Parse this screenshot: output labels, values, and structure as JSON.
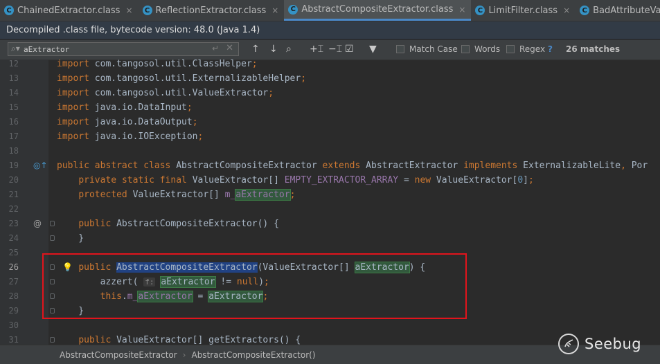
{
  "tabs": [
    {
      "label": "ChainedExtractor.class",
      "active": false
    },
    {
      "label": "ReflectionExtractor.class",
      "active": false
    },
    {
      "label": "AbstractCompositeExtractor.class",
      "active": true
    },
    {
      "label": "LimitFilter.class",
      "active": false
    },
    {
      "label": "BadAttributeValueExpException",
      "active": false
    }
  ],
  "tab_icon_letter": "C",
  "tab_close_glyph": "×",
  "banner": {
    "text": "Decompiled .class file, bytecode version: 48.0 (Java 1.4)"
  },
  "find": {
    "query": "aExtractor",
    "options": {
      "match_case": "Match Case",
      "words": "Words",
      "regex": "Regex",
      "help": "?"
    },
    "matches": "26 matches"
  },
  "code_lines": [
    {
      "n": "12",
      "text": "import com.tangosol.util.ClassHelper;"
    },
    {
      "n": "13",
      "text": "import com.tangosol.util.ExternalizableHelper;"
    },
    {
      "n": "14",
      "text": "import com.tangosol.util.ValueExtractor;"
    },
    {
      "n": "15",
      "text": "import java.io.DataInput;"
    },
    {
      "n": "16",
      "text": "import java.io.DataOutput;"
    },
    {
      "n": "17",
      "text": "import java.io.IOException;"
    },
    {
      "n": "18",
      "text": ""
    },
    {
      "n": "19",
      "text": "public abstract class AbstractCompositeExtractor extends AbstractExtractor implements ExternalizableLite, Por"
    },
    {
      "n": "20",
      "text": "    private static final ValueExtractor[] EMPTY_EXTRACTOR_ARRAY = new ValueExtractor[0];"
    },
    {
      "n": "21",
      "text": "    protected ValueExtractor[] m_aExtractor;"
    },
    {
      "n": "22",
      "text": ""
    },
    {
      "n": "23",
      "text": "    public AbstractCompositeExtractor() {"
    },
    {
      "n": "24",
      "text": "    }"
    },
    {
      "n": "25",
      "text": ""
    },
    {
      "n": "26",
      "text": "    public AbstractCompositeExtractor(ValueExtractor[] aExtractor) {"
    },
    {
      "n": "27",
      "text": "        azzert( f: aExtractor != null);"
    },
    {
      "n": "28",
      "text": "        this.m_aExtractor = aExtractor;"
    },
    {
      "n": "29",
      "text": "    }"
    },
    {
      "n": "30",
      "text": ""
    },
    {
      "n": "31",
      "text": "    public ValueExtractor[] getExtractors() {"
    }
  ],
  "breadcrumb": [
    "AbstractCompositeExtractor",
    "AbstractCompositeExtractor()"
  ],
  "watermark": "Seebug",
  "colors": {
    "background": "#2b2b2b",
    "keyword": "#cc7832",
    "number": "#6897bb",
    "field": "#9876aa",
    "match_highlight": "#32593d",
    "selection": "#214283",
    "annotation_box": "#e2141c"
  }
}
